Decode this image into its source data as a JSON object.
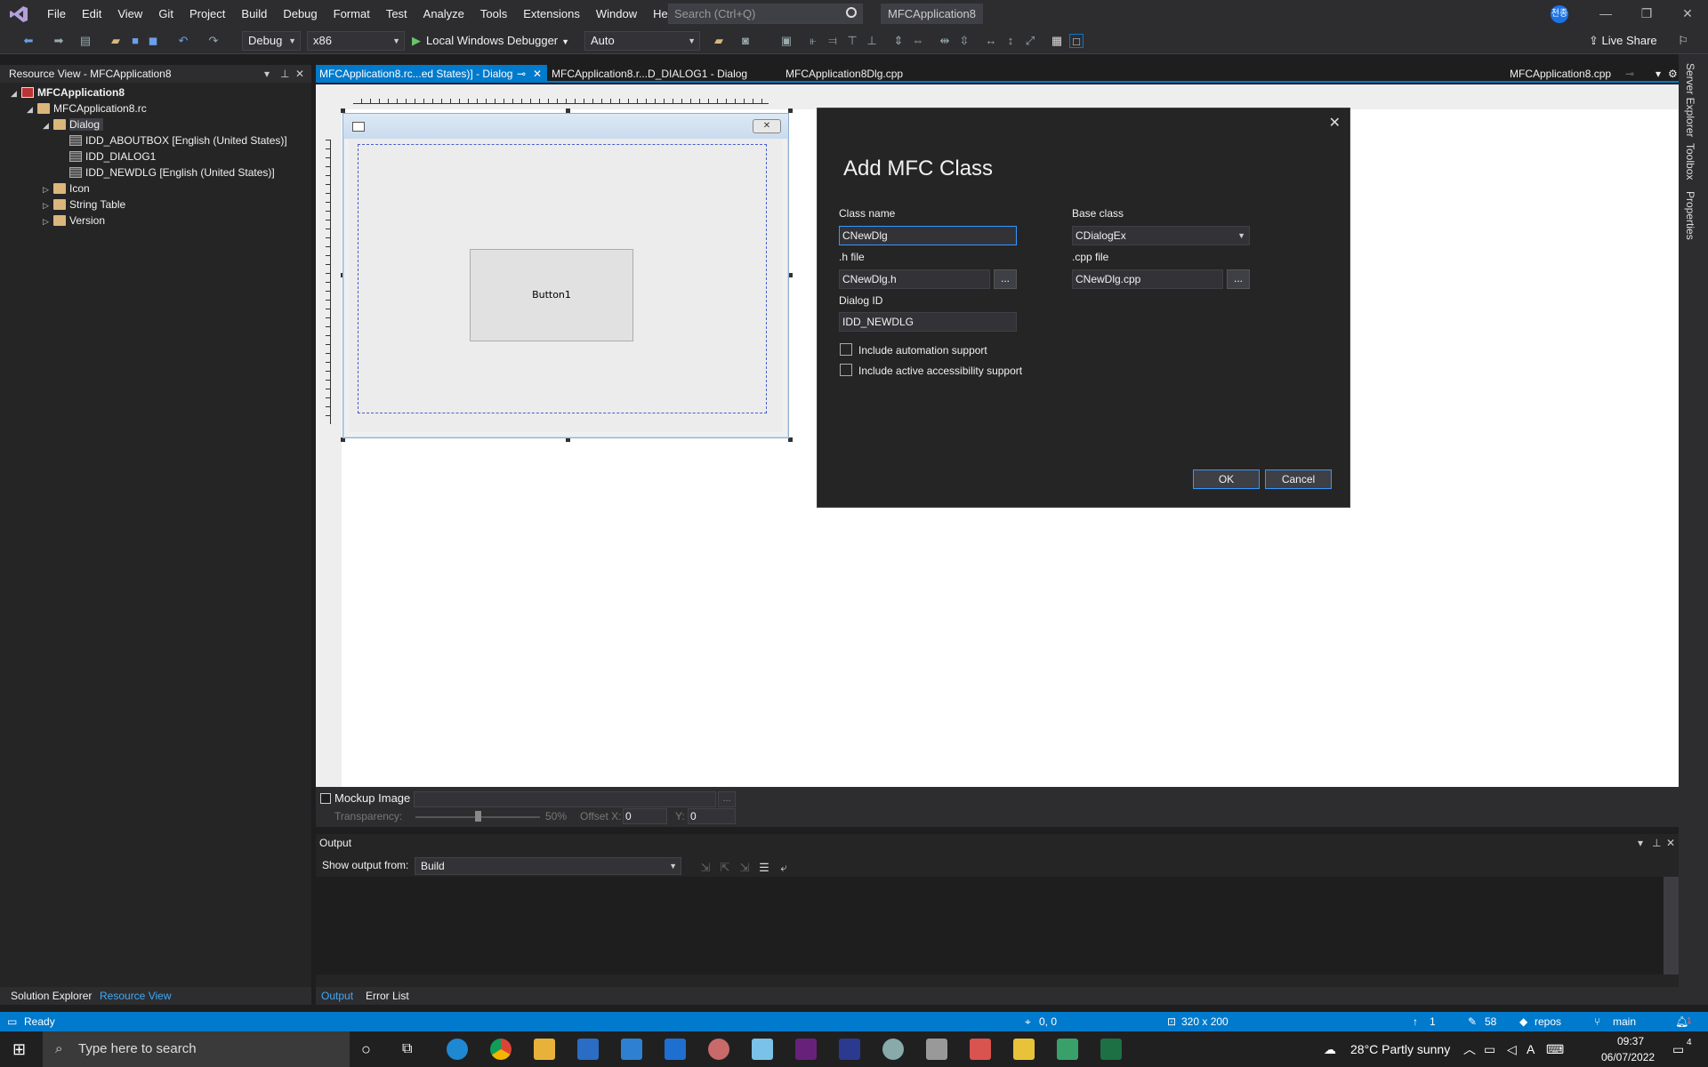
{
  "menubar": {
    "items": [
      "File",
      "Edit",
      "View",
      "Git",
      "Project",
      "Build",
      "Debug",
      "Format",
      "Test",
      "Analyze",
      "Tools",
      "Extensions",
      "Window",
      "Help"
    ],
    "search_placeholder": "Search (Ctrl+Q)",
    "app_name": "MFCApplication8",
    "avatar": "천종"
  },
  "toolbar": {
    "config": "Debug",
    "platform": "x86",
    "debugger": "Local Windows Debugger",
    "mode": "Auto",
    "live_share": "Live Share"
  },
  "resource_view": {
    "title": "Resource View - MFCApplication8",
    "tree": [
      {
        "label": "MFCApplication8",
        "level": 0,
        "expanded": true,
        "bold": true
      },
      {
        "label": "MFCApplication8.rc",
        "level": 1,
        "expanded": true
      },
      {
        "label": "Dialog",
        "level": 2,
        "expanded": true,
        "selected": true
      },
      {
        "label": "IDD_ABOUTBOX [English (United States)]",
        "level": 3
      },
      {
        "label": "IDD_DIALOG1",
        "level": 3
      },
      {
        "label": "IDD_NEWDLG [English (United States)]",
        "level": 3
      },
      {
        "label": "Icon",
        "level": 2,
        "expanded": false
      },
      {
        "label": "String Table",
        "level": 2,
        "expanded": false
      },
      {
        "label": "Version",
        "level": 2,
        "expanded": false
      }
    ],
    "bottom_tabs": [
      "Solution Explorer",
      "Resource View"
    ]
  },
  "doc_tabs": {
    "tab1": "MFCApplication8.rc...ed States)] - Dialog",
    "tab2": "MFCApplication8.r...D_DIALOG1 - Dialog",
    "tab3": "MFCApplication8Dlg.cpp",
    "tab_right": "MFCApplication8.cpp"
  },
  "designer": {
    "button_label": "Button1",
    "mockup_label": "Mockup Image",
    "transparency_label": "Transparency:",
    "transparency_value": "50%",
    "offset_x_label": "Offset X:",
    "offset_x": "0",
    "offset_y_label": "Y:",
    "offset_y": "0",
    "transparency_fraction": 0.5
  },
  "mfc_dialog": {
    "title": "Add MFC Class",
    "class_name_label": "Class name",
    "class_name": "CNewDlg",
    "base_class_label": "Base class",
    "base_class": "CDialogEx",
    "h_file_label": ".h file",
    "h_file": "CNewDlg.h",
    "cpp_file_label": ".cpp file",
    "cpp_file": "CNewDlg.cpp",
    "browse": "...",
    "dialog_id_label": "Dialog ID",
    "dialog_id": "IDD_NEWDLG",
    "automation_label": "Include automation support",
    "accessibility_label": "Include active accessibility support",
    "ok": "OK",
    "cancel": "Cancel"
  },
  "right_sidebar": [
    "Server Explorer",
    "Toolbox",
    "Properties"
  ],
  "output": {
    "title": "Output",
    "show_from_label": "Show output from:",
    "show_from": "Build",
    "bottom_tabs": [
      "Output",
      "Error List"
    ]
  },
  "statusbar": {
    "ready": "Ready",
    "position": "0, 0",
    "size": "320 x 200",
    "up_count": "1",
    "edits": "58",
    "repo": "repos",
    "branch": "main",
    "notifications": "1"
  },
  "taskbar": {
    "search_placeholder": "Type here to search",
    "weather": "28°C  Partly sunny",
    "time": "09:37",
    "date": "06/07/2022",
    "notif_count": "4"
  },
  "colors": {
    "accent": "#007acc",
    "background": "#1e1e1e",
    "panel": "#252526"
  }
}
